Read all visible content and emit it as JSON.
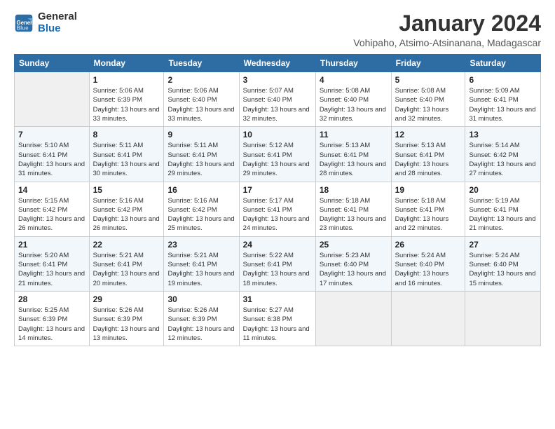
{
  "header": {
    "logo_line1": "General",
    "logo_line2": "Blue",
    "title": "January 2024",
    "subtitle": "Vohipaho, Atsimo-Atsinanana, Madagascar"
  },
  "weekdays": [
    "Sunday",
    "Monday",
    "Tuesday",
    "Wednesday",
    "Thursday",
    "Friday",
    "Saturday"
  ],
  "weeks": [
    [
      {
        "day": "",
        "empty": true
      },
      {
        "day": "1",
        "sunrise": "Sunrise: 5:06 AM",
        "sunset": "Sunset: 6:39 PM",
        "daylight": "Daylight: 13 hours and 33 minutes."
      },
      {
        "day": "2",
        "sunrise": "Sunrise: 5:06 AM",
        "sunset": "Sunset: 6:40 PM",
        "daylight": "Daylight: 13 hours and 33 minutes."
      },
      {
        "day": "3",
        "sunrise": "Sunrise: 5:07 AM",
        "sunset": "Sunset: 6:40 PM",
        "daylight": "Daylight: 13 hours and 32 minutes."
      },
      {
        "day": "4",
        "sunrise": "Sunrise: 5:08 AM",
        "sunset": "Sunset: 6:40 PM",
        "daylight": "Daylight: 13 hours and 32 minutes."
      },
      {
        "day": "5",
        "sunrise": "Sunrise: 5:08 AM",
        "sunset": "Sunset: 6:40 PM",
        "daylight": "Daylight: 13 hours and 32 minutes."
      },
      {
        "day": "6",
        "sunrise": "Sunrise: 5:09 AM",
        "sunset": "Sunset: 6:41 PM",
        "daylight": "Daylight: 13 hours and 31 minutes."
      }
    ],
    [
      {
        "day": "7",
        "sunrise": "Sunrise: 5:10 AM",
        "sunset": "Sunset: 6:41 PM",
        "daylight": "Daylight: 13 hours and 31 minutes."
      },
      {
        "day": "8",
        "sunrise": "Sunrise: 5:11 AM",
        "sunset": "Sunset: 6:41 PM",
        "daylight": "Daylight: 13 hours and 30 minutes."
      },
      {
        "day": "9",
        "sunrise": "Sunrise: 5:11 AM",
        "sunset": "Sunset: 6:41 PM",
        "daylight": "Daylight: 13 hours and 29 minutes."
      },
      {
        "day": "10",
        "sunrise": "Sunrise: 5:12 AM",
        "sunset": "Sunset: 6:41 PM",
        "daylight": "Daylight: 13 hours and 29 minutes."
      },
      {
        "day": "11",
        "sunrise": "Sunrise: 5:13 AM",
        "sunset": "Sunset: 6:41 PM",
        "daylight": "Daylight: 13 hours and 28 minutes."
      },
      {
        "day": "12",
        "sunrise": "Sunrise: 5:13 AM",
        "sunset": "Sunset: 6:41 PM",
        "daylight": "Daylight: 13 hours and 28 minutes."
      },
      {
        "day": "13",
        "sunrise": "Sunrise: 5:14 AM",
        "sunset": "Sunset: 6:42 PM",
        "daylight": "Daylight: 13 hours and 27 minutes."
      }
    ],
    [
      {
        "day": "14",
        "sunrise": "Sunrise: 5:15 AM",
        "sunset": "Sunset: 6:42 PM",
        "daylight": "Daylight: 13 hours and 26 minutes."
      },
      {
        "day": "15",
        "sunrise": "Sunrise: 5:16 AM",
        "sunset": "Sunset: 6:42 PM",
        "daylight": "Daylight: 13 hours and 26 minutes."
      },
      {
        "day": "16",
        "sunrise": "Sunrise: 5:16 AM",
        "sunset": "Sunset: 6:42 PM",
        "daylight": "Daylight: 13 hours and 25 minutes."
      },
      {
        "day": "17",
        "sunrise": "Sunrise: 5:17 AM",
        "sunset": "Sunset: 6:41 PM",
        "daylight": "Daylight: 13 hours and 24 minutes."
      },
      {
        "day": "18",
        "sunrise": "Sunrise: 5:18 AM",
        "sunset": "Sunset: 6:41 PM",
        "daylight": "Daylight: 13 hours and 23 minutes."
      },
      {
        "day": "19",
        "sunrise": "Sunrise: 5:18 AM",
        "sunset": "Sunset: 6:41 PM",
        "daylight": "Daylight: 13 hours and 22 minutes."
      },
      {
        "day": "20",
        "sunrise": "Sunrise: 5:19 AM",
        "sunset": "Sunset: 6:41 PM",
        "daylight": "Daylight: 13 hours and 21 minutes."
      }
    ],
    [
      {
        "day": "21",
        "sunrise": "Sunrise: 5:20 AM",
        "sunset": "Sunset: 6:41 PM",
        "daylight": "Daylight: 13 hours and 21 minutes."
      },
      {
        "day": "22",
        "sunrise": "Sunrise: 5:21 AM",
        "sunset": "Sunset: 6:41 PM",
        "daylight": "Daylight: 13 hours and 20 minutes."
      },
      {
        "day": "23",
        "sunrise": "Sunrise: 5:21 AM",
        "sunset": "Sunset: 6:41 PM",
        "daylight": "Daylight: 13 hours and 19 minutes."
      },
      {
        "day": "24",
        "sunrise": "Sunrise: 5:22 AM",
        "sunset": "Sunset: 6:41 PM",
        "daylight": "Daylight: 13 hours and 18 minutes."
      },
      {
        "day": "25",
        "sunrise": "Sunrise: 5:23 AM",
        "sunset": "Sunset: 6:40 PM",
        "daylight": "Daylight: 13 hours and 17 minutes."
      },
      {
        "day": "26",
        "sunrise": "Sunrise: 5:24 AM",
        "sunset": "Sunset: 6:40 PM",
        "daylight": "Daylight: 13 hours and 16 minutes."
      },
      {
        "day": "27",
        "sunrise": "Sunrise: 5:24 AM",
        "sunset": "Sunset: 6:40 PM",
        "daylight": "Daylight: 13 hours and 15 minutes."
      }
    ],
    [
      {
        "day": "28",
        "sunrise": "Sunrise: 5:25 AM",
        "sunset": "Sunset: 6:39 PM",
        "daylight": "Daylight: 13 hours and 14 minutes."
      },
      {
        "day": "29",
        "sunrise": "Sunrise: 5:26 AM",
        "sunset": "Sunset: 6:39 PM",
        "daylight": "Daylight: 13 hours and 13 minutes."
      },
      {
        "day": "30",
        "sunrise": "Sunrise: 5:26 AM",
        "sunset": "Sunset: 6:39 PM",
        "daylight": "Daylight: 13 hours and 12 minutes."
      },
      {
        "day": "31",
        "sunrise": "Sunrise: 5:27 AM",
        "sunset": "Sunset: 6:38 PM",
        "daylight": "Daylight: 13 hours and 11 minutes."
      },
      {
        "day": "",
        "empty": true
      },
      {
        "day": "",
        "empty": true
      },
      {
        "day": "",
        "empty": true
      }
    ]
  ]
}
